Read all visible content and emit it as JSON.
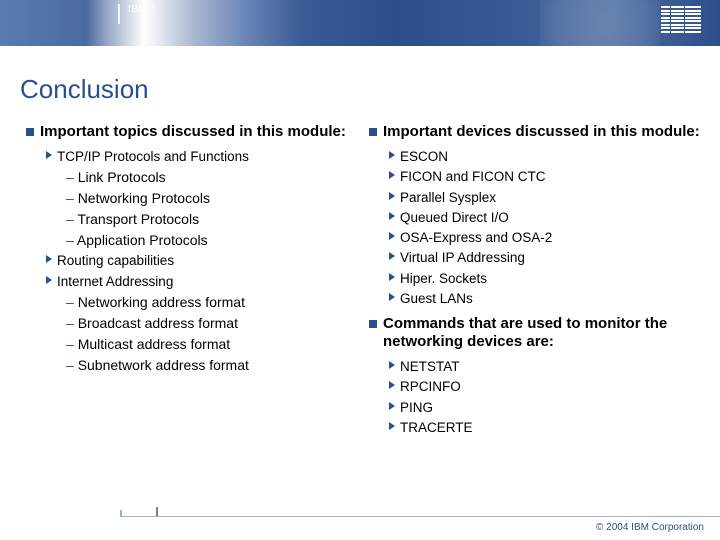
{
  "header": {
    "brand": "IBM ^",
    "logo_name": "ibm-logo"
  },
  "title": "Conclusion",
  "left": {
    "heading": "Important topics discussed in this module:",
    "items": [
      {
        "type": "tri",
        "text": "TCP/IP Protocols and Functions"
      },
      {
        "type": "dash",
        "text": "Link Protocols"
      },
      {
        "type": "dash",
        "text": "Networking Protocols"
      },
      {
        "type": "dash",
        "text": "Transport Protocols"
      },
      {
        "type": "dash",
        "text": "Application Protocols"
      },
      {
        "type": "tri",
        "text": "Routing capabilities"
      },
      {
        "type": "tri",
        "text": "Internet Addressing"
      },
      {
        "type": "dash",
        "text": "Networking address format"
      },
      {
        "type": "dash",
        "text": "Broadcast address format"
      },
      {
        "type": "dash",
        "text": "Multicast address format"
      },
      {
        "type": "dash",
        "text": "Subnetwork address format"
      }
    ]
  },
  "right": {
    "heading1": "Important devices discussed in this module:",
    "devices": [
      "ESCON",
      "FICON and FICON CTC",
      "Parallel Sysplex",
      "Queued Direct I/O",
      "OSA-Express and OSA-2",
      "Virtual IP Addressing",
      "Hiper. Sockets",
      "Guest LANs"
    ],
    "heading2": "Commands that are used to monitor the networking devices are:",
    "commands": [
      "NETSTAT",
      "RPCINFO",
      "PING",
      "TRACERTE"
    ]
  },
  "footer": {
    "copyright": "© 2004 IBM Corporation"
  }
}
